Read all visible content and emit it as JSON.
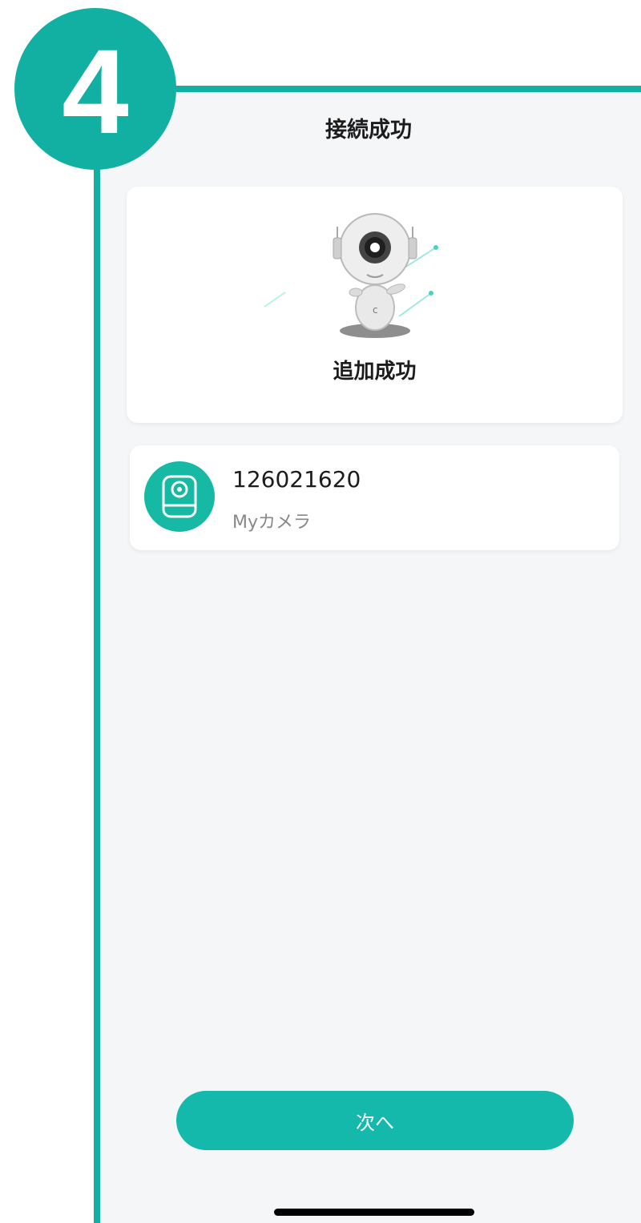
{
  "step": {
    "number": "4"
  },
  "header": {
    "title": "接続成功"
  },
  "success": {
    "label": "追加成功"
  },
  "device": {
    "id": "126021620",
    "name": "Myカメラ"
  },
  "footer": {
    "next_label": "次へ"
  },
  "colors": {
    "accent": "#12b0a3",
    "button": "#14b9ac",
    "background": "#f5f6f8"
  }
}
